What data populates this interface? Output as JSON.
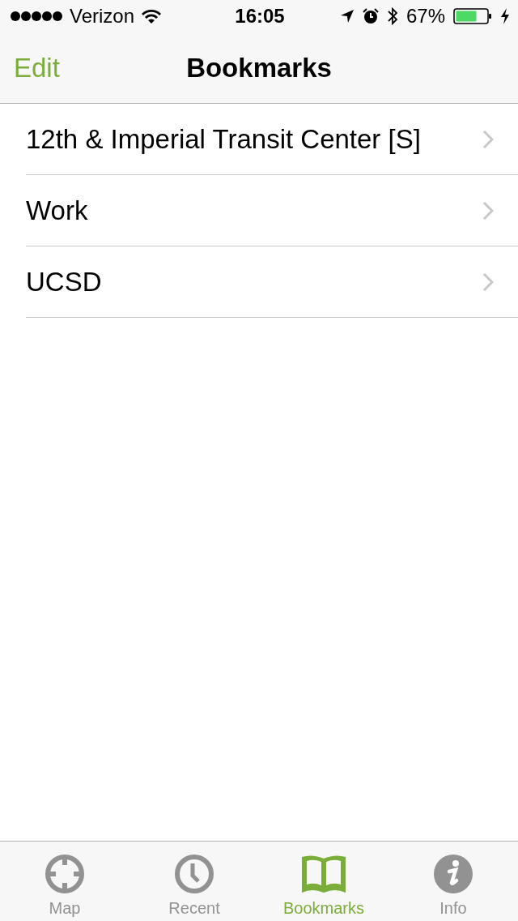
{
  "status_bar": {
    "carrier": "Verizon",
    "time": "16:05",
    "battery": "67%"
  },
  "nav_bar": {
    "edit": "Edit",
    "title": "Bookmarks"
  },
  "bookmarks": [
    {
      "label": "12th & Imperial Transit Center [S]"
    },
    {
      "label": "Work"
    },
    {
      "label": "UCSD"
    }
  ],
  "tab_bar": [
    {
      "kind": "map",
      "label": "Map",
      "selected": false
    },
    {
      "kind": "recent",
      "label": "Recent",
      "selected": false
    },
    {
      "kind": "bookmarks",
      "label": "Bookmarks",
      "selected": true
    },
    {
      "kind": "info",
      "label": "Info",
      "selected": false
    }
  ]
}
